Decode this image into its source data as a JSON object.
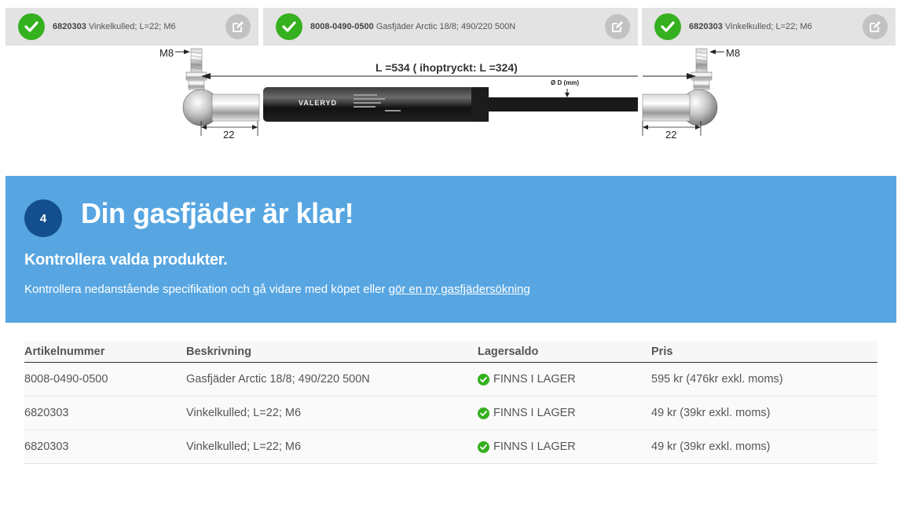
{
  "selected_products": [
    {
      "article": "6820303",
      "description": "Vinkelkulled; L=22; M6"
    },
    {
      "article": "8008-0490-0500",
      "description": "Gasfjäder Arctic 18/8; 490/220 500N"
    },
    {
      "article": "6820303",
      "description": "Vinkelkulled; L=22; M6"
    }
  ],
  "illustration": {
    "length_label": "L =534 ( ihoptryckt: L =324)",
    "thread_left": "M8",
    "thread_right": "M8",
    "dim_left": "22",
    "dim_right": "22",
    "diameter_label": "Ø D (mm)",
    "brand": "VALERYD"
  },
  "step": {
    "number": "4",
    "title": "Din gasfjäder är klar!",
    "subtitle": "Kontrollera valda produkter.",
    "text": "Kontrollera nedanstående specifikation och gå vidare med köpet eller ",
    "link": "gör en ny gasfjädersökning"
  },
  "table": {
    "headers": [
      "Artikelnummer",
      "Beskrivning",
      "Lagersaldo",
      "Pris"
    ],
    "rows": [
      {
        "article": "8008-0490-0500",
        "description": "Gasfjäder Arctic 18/8; 490/220 500N",
        "stock": "FINNS I LAGER",
        "price": "595 kr (476kr exkl. moms)"
      },
      {
        "article": "6820303",
        "description": "Vinkelkulled; L=22; M6",
        "stock": "FINNS I LAGER",
        "price": "49 kr (39kr exkl. moms)"
      },
      {
        "article": "6820303",
        "description": "Vinkelkulled; L=22; M6",
        "stock": "FINNS I LAGER",
        "price": "49 kr (39kr exkl. moms)"
      }
    ]
  },
  "colors": {
    "check_green": "#35b01f",
    "panel_blue": "#57a6e2",
    "step_circle": "#134f8f"
  }
}
